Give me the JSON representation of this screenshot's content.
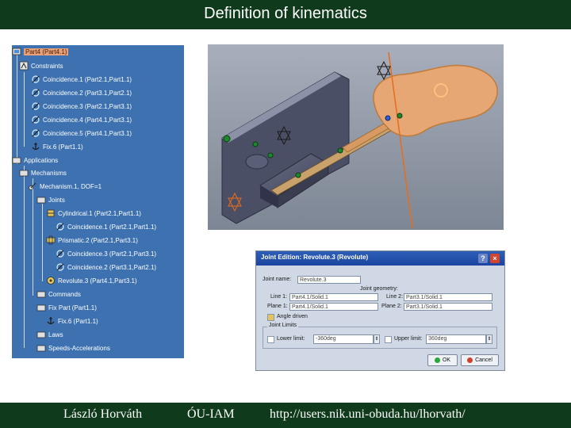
{
  "header": {
    "title": "Definition of kinematics"
  },
  "footer": {
    "author": "László Horváth",
    "institution": "ÓU-IAM",
    "url": "http://users.nik.uni-obuda.hu/lhorvath/"
  },
  "colors": {
    "bar": "#0f3a1b",
    "tree_bg": "#3d71b0",
    "part_orange": "#e6a774",
    "dialog_bg": "#cfd8e4"
  },
  "tree": {
    "root": "Part4 (Part4.1)",
    "constraints": "Constraints",
    "coincidences": [
      "Coincidence.1 (Part2.1,Part1.1)",
      "Coincidence.2 (Part3.1,Part2.1)",
      "Coincidence.3 (Part2.1,Part3.1)",
      "Coincidence.4 (Part4.1,Part3.1)",
      "Coincidence.5 (Part4.1,Part3.1)"
    ],
    "fix": "Fix.6 (Part1.1)",
    "applications": "Applications",
    "mechanisms": "Mechanisms",
    "mechanism1": "Mechanism.1, DOF=1",
    "joints": "Joints",
    "cylindrical": "Cylindrical.1 (Part2.1,Part1.1)",
    "cyl_coincidence": "Coincidence.1 (Part2.1,Part1.1)",
    "prismatic": "Prismatic.2 (Part2.1,Part3.1)",
    "pri_coincidence3": "Coincidence.3 (Part2.1,Part3.1)",
    "pri_coincidence2": "Coincidence.2 (Part3.1,Part2.1)",
    "revolute": "Revolute.3 (Part4.1,Part3.1)",
    "commands": "Commands",
    "fixpart": "Fix Part (Part1.1)",
    "fixpart_fix": "Fix.6 (Part1.1)",
    "laws": "Laws",
    "speeds": "Speeds-Accelerations"
  },
  "dialog": {
    "title": "Joint Edition: Revolute.3 (Revolute)",
    "help_btn": "?",
    "close_btn": "×",
    "joint_name_label": "Joint name:",
    "joint_name_value": "Revolute.3",
    "joint_geometry_label": "Joint geometry:",
    "line1_label": "Line 1:",
    "line1_value": "Part4.1/Solid.1",
    "line2_label": "Line 2:",
    "line2_value": "Part3.1/Solid.1",
    "plane1_label": "Plane 1:",
    "plane1_value": "Part4.1/Solid.1",
    "plane2_label": "Plane 2:",
    "plane2_value": "Part3.1/Solid.1",
    "angle_driven_label": "Angle driven",
    "joint_limits_label": "Joint Limits",
    "lower_limit_label": "Lower limit:",
    "lower_limit_value": "-360deg",
    "upper_limit_label": "Upper limit:",
    "upper_limit_value": "360deg",
    "ok_label": "OK",
    "cancel_label": "Cancel"
  }
}
